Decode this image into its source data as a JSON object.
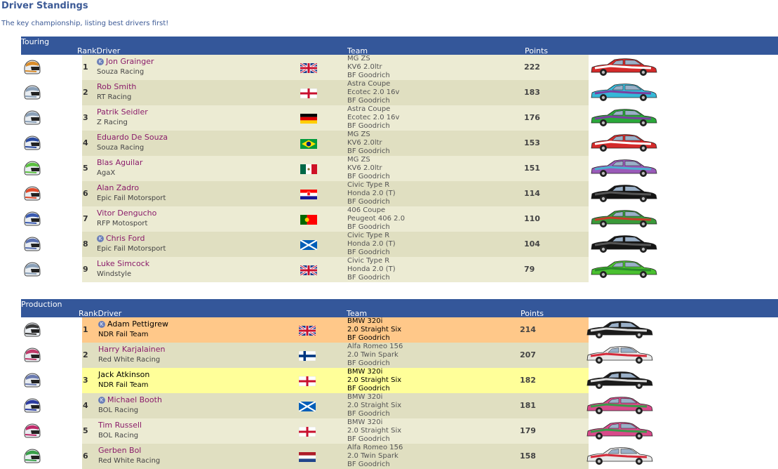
{
  "page": {
    "title": "Driver Standings",
    "subtitle": "The key championship, listing best drivers first!"
  },
  "columns": {
    "rank_driver": "RankDriver",
    "team": "Team",
    "points": "Points"
  },
  "sections": [
    {
      "name": "Touring",
      "drivers": [
        {
          "rank": "1",
          "name": "Jon Grainger",
          "team": "Souza Racing",
          "badge": true,
          "country": "uk",
          "car": [
            "MG ZS",
            "KV6 2.0ltr",
            "BF Goodrich"
          ],
          "points": "222",
          "helmet": "#d98c2a",
          "car_color": "#d42a2a",
          "car_accent": "#ffffff"
        },
        {
          "rank": "2",
          "name": "Rob Smith",
          "team": "RT Racing",
          "badge": false,
          "country": "england",
          "car": [
            "Astra Coupe",
            "Ecotec 2.0 16v",
            "BF Goodrich"
          ],
          "points": "183",
          "helmet": "#8aa0b8",
          "car_color": "#36b8d8",
          "car_accent": "#7a3fa0"
        },
        {
          "rank": "3",
          "name": "Patrik Seidler",
          "team": "Z Racing",
          "badge": false,
          "country": "germany",
          "car": [
            "Astra Coupe",
            "Ecotec 2.0 16v",
            "BF Goodrich"
          ],
          "points": "176",
          "helmet": "#8aa0b8",
          "car_color": "#2aa83a",
          "car_accent": "#7a3fa0"
        },
        {
          "rank": "4",
          "name": "Eduardo De Souza",
          "team": "Souza Racing",
          "badge": false,
          "country": "brazil",
          "car": [
            "MG ZS",
            "KV6 2.0ltr",
            "BF Goodrich"
          ],
          "points": "153",
          "helmet": "#2a4aa0",
          "car_color": "#d42a2a",
          "car_accent": "#ffffff"
        },
        {
          "rank": "5",
          "name": "Blas Aguilar",
          "team": "AgaX",
          "badge": false,
          "country": "mexico",
          "car": [
            "MG ZS",
            "KV6 2.0ltr",
            "BF Goodrich"
          ],
          "points": "151",
          "helmet": "#5cc040",
          "car_color": "#9a5ab8",
          "car_accent": "#4ab0d0"
        },
        {
          "rank": "6",
          "name": "Alan Zadro",
          "team": "Epic Fail Motorsport",
          "badge": false,
          "country": "croatia",
          "car": [
            "Civic Type R",
            "Honda 2.0 (T)",
            "BF Goodrich"
          ],
          "points": "114",
          "helmet": "#e04a2a",
          "car_color": "#151515",
          "car_accent": "#555555"
        },
        {
          "rank": "7",
          "name": "Vitor Dengucho",
          "team": "RFP Motosport",
          "badge": false,
          "country": "portugal",
          "car": [
            "406 Coupe",
            "Peugeot 406 2.0",
            "BF Goodrich"
          ],
          "points": "110",
          "helmet": "#3a5ab0",
          "car_color": "#3a9a3a",
          "car_accent": "#c83a2a"
        },
        {
          "rank": "8",
          "name": "Chris Ford",
          "team": "Epic Fail Motorsport",
          "badge": true,
          "country": "scotland",
          "car": [
            "Civic Type R",
            "Honda 2.0 (T)",
            "BF Goodrich"
          ],
          "points": "104",
          "helmet": "#5a70b0",
          "car_color": "#151515",
          "car_accent": "#555555"
        },
        {
          "rank": "9",
          "name": "Luke Simcock",
          "team": "Windstyle",
          "badge": false,
          "country": "uk",
          "car": [
            "Civic Type R",
            "Honda 2.0 (T)",
            "BF Goodrich"
          ],
          "points": "79",
          "helmet": "#8aa0b8",
          "car_color": "#4ac030",
          "car_accent": "#2a8a2a"
        }
      ]
    },
    {
      "name": "Production",
      "drivers": [
        {
          "rank": "1",
          "name": "Adam Pettigrew",
          "team": "NDR Fail Team",
          "badge": true,
          "country": "uk",
          "car": [
            "BMW 320i",
            "2.0 Straight Six",
            "BF Goodrich"
          ],
          "points": "214",
          "helmet": "#3a3a3a",
          "car_color": "#1a1a1a",
          "car_accent": "#dddddd",
          "highlight": "orange"
        },
        {
          "rank": "2",
          "name": "Harry Karjalainen",
          "team": "Red White Racing",
          "badge": false,
          "country": "finland",
          "car": [
            "Alfa Romeo 156",
            "2.0 Twin Spark",
            "BF Goodrich"
          ],
          "points": "207",
          "helmet": "#c03a6a",
          "car_color": "#e8e8e8",
          "car_accent": "#d42a3a"
        },
        {
          "rank": "3",
          "name": "Jack Atkinson",
          "team": "NDR Fail Team",
          "badge": false,
          "country": "england",
          "car": [
            "BMW 320i",
            "2.0 Straight Six",
            "BF Goodrich"
          ],
          "points": "182",
          "helmet": "#6a7ab0",
          "car_color": "#1a1a1a",
          "car_accent": "#dddddd",
          "highlight": "yellow"
        },
        {
          "rank": "4",
          "name": "Michael Booth",
          "team": "BOL Racing",
          "badge": true,
          "country": "scotland",
          "car": [
            "BMW 320i",
            "2.0 Straight Six",
            "BF Goodrich"
          ],
          "points": "181",
          "helmet": "#2a3aa0",
          "car_color": "#d84a8a",
          "car_accent": "#3a9a4a"
        },
        {
          "rank": "5",
          "name": "Tim Russell",
          "team": "BOL Racing",
          "badge": false,
          "country": "england",
          "car": [
            "BMW 320i",
            "2.0 Straight Six",
            "BF Goodrich"
          ],
          "points": "179",
          "helmet": "#c02a6a",
          "car_color": "#d84a8a",
          "car_accent": "#3a9a4a"
        },
        {
          "rank": "6",
          "name": "Gerben Bol",
          "team": "Red White Racing",
          "badge": false,
          "country": "netherlands",
          "car": [
            "Alfa Romeo 156",
            "2.0 Twin Spark",
            "BF Goodrich"
          ],
          "points": "158",
          "helmet": "#3aa04a",
          "car_color": "#e8e8e8",
          "car_accent": "#d42a3a"
        }
      ]
    }
  ]
}
